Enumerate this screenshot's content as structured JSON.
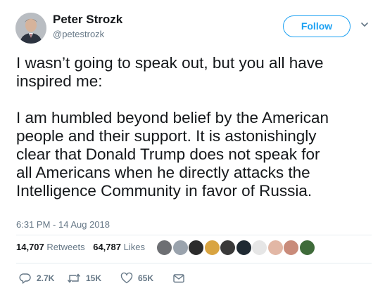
{
  "author": {
    "name": "Peter Strozk",
    "handle": "@petestrozk",
    "avatar_icon": "profile-photo"
  },
  "follow_label": "Follow",
  "tweet": {
    "lines_paragraph_1": [
      "I wasn’t going to speak out, but you all have",
      "inspired me:"
    ],
    "lines_paragraph_2": [
      "I am humbled beyond belief by the American",
      "people and their support. It is astonishingly",
      "clear that Donald Trump does not speak for",
      "all Americans when he directly attacks the",
      "Intelligence Community in favor of Russia."
    ]
  },
  "timestamp": "6:31 PM - 14 Aug 2018",
  "stats": {
    "retweets_count": "14,707",
    "retweets_label": "Retweets",
    "likes_count": "64,787",
    "likes_label": "Likes"
  },
  "liker_avatars": [
    "#6d6f73",
    "#9aa3ad",
    "#2b2b2b",
    "#d9a441",
    "#3a3a3a",
    "#1f2a33",
    "#e6e6e6",
    "#e2b7a5",
    "#c98b7a",
    "#3f6b3a"
  ],
  "actions": {
    "reply_count": "2.7K",
    "retweet_count": "15K",
    "like_count": "65K"
  },
  "colors": {
    "accent": "#1da1f2",
    "secondary_text": "#657786",
    "primary_text": "#14171a"
  }
}
